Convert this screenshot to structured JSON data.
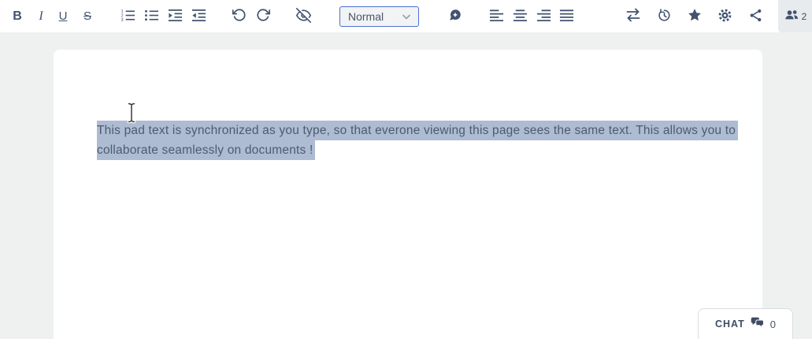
{
  "toolbar": {
    "bold_label": "B",
    "italic_label": "I",
    "underline_label": "U",
    "strikethrough_label": "S",
    "style_select": {
      "value": "Normal"
    },
    "users_count": "2",
    "icons": [
      "bold",
      "italic",
      "underline",
      "strikethrough",
      "ordered-list",
      "unordered-list",
      "indent",
      "outdent",
      "undo",
      "redo",
      "hide-authorship-colors",
      "style-select",
      "add-comment",
      "align-left",
      "align-center",
      "align-right",
      "align-justify",
      "import-export",
      "history",
      "favorite",
      "settings",
      "share",
      "connected-users"
    ]
  },
  "editor": {
    "lines": [
      "This pad text is synchronized as you type, so that everone viewing this page sees the same text. This allows you to",
      "collaborate seamlessly on documents !"
    ]
  },
  "chat": {
    "label": "CHAT",
    "count": "0"
  },
  "colors": {
    "page_background": "#eff1f1",
    "toolbar_background": "#ffffff",
    "icon": "#42526e",
    "selection_highlight": "#adbcd3",
    "editor_text": "#4d5b6d",
    "select_focus_border": "#4d6fd3",
    "active_button_background": "#e8ebee"
  }
}
